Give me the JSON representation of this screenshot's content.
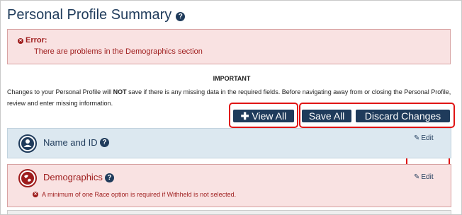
{
  "page": {
    "title": "Personal Profile Summary"
  },
  "error": {
    "label": "Error:",
    "message": "There are problems in the Demographics section"
  },
  "important": {
    "heading": "IMPORTANT",
    "text_before": "Changes to your Personal Profile will ",
    "text_bold": "NOT",
    "text_after": " save if there is any missing data in the required fields. Before navigating away from or closing the Personal Profile, review and enter missing information."
  },
  "buttons": {
    "view_all": "View All",
    "save_all": "Save All",
    "discard": "Discard Changes"
  },
  "sections": [
    {
      "title": "Name and ID",
      "edit": "Edit",
      "icon": "user-icon",
      "status": "ok"
    },
    {
      "title": "Demographics",
      "edit": "Edit",
      "icon": "globe-icon",
      "status": "error",
      "error": "A minimum of one Race option is required if Withheld is not selected."
    }
  ],
  "colors": {
    "navy": "#1f3b5b",
    "error_red": "#9e1c1c",
    "error_bg": "#f9e2e2",
    "info_bg": "#dce8f0",
    "highlight": "#e01414"
  }
}
